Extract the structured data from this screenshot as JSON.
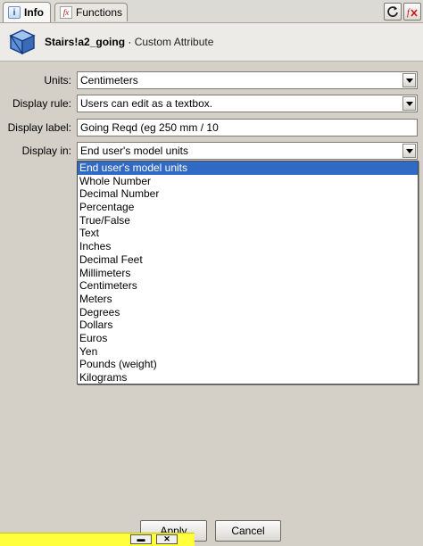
{
  "tabs": [
    {
      "label": "Info",
      "icon": "info-icon"
    },
    {
      "label": "Functions",
      "icon": "fx-icon"
    }
  ],
  "toolbar": {
    "refresh_icon": "refresh-icon",
    "remove_icon": "remove-fx-icon"
  },
  "header": {
    "object_name": "Stairs!a2_going",
    "separator": " · ",
    "object_kind": "Custom Attribute"
  },
  "form": {
    "units": {
      "label": "Units:",
      "value": "Centimeters"
    },
    "display_rule": {
      "label": "Display rule:",
      "value": "Users can edit as a textbox."
    },
    "display_label": {
      "label": "Display label:",
      "value": "Going Reqd (eg 250 mm / 10"
    },
    "display_in": {
      "label": "Display in:",
      "value": "End user's model units"
    }
  },
  "dropdown": {
    "selected_index": 0,
    "options": [
      "End user's model units",
      "Whole Number",
      "Decimal Number",
      "Percentage",
      "True/False",
      "Text",
      "Inches",
      "Decimal Feet",
      "Millimeters",
      "Centimeters",
      "Meters",
      "Degrees",
      "Dollars",
      "Euros",
      "Yen",
      "Pounds (weight)",
      "Kilograms"
    ]
  },
  "buttons": {
    "apply": "Apply",
    "cancel": "Cancel"
  },
  "statusbar": {
    "minimize": "▬",
    "close": "✕"
  },
  "colors": {
    "selection": "#316ac5",
    "panel": "#d4d0c8",
    "statusbar": "#ffff3c"
  }
}
